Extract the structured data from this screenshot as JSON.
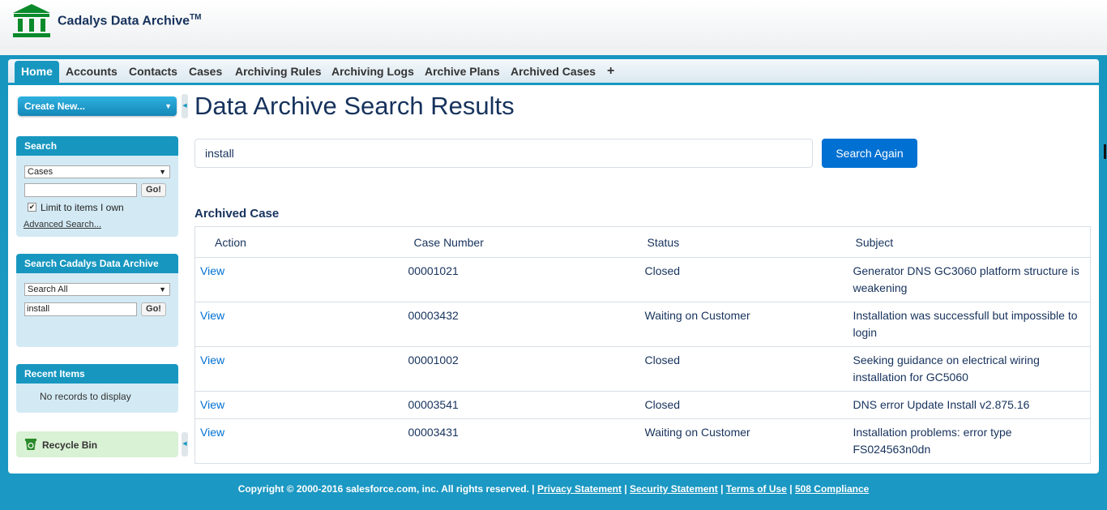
{
  "header": {
    "app_title": "Cadalys Data Archive",
    "trademark": "TM"
  },
  "tabs": [
    {
      "label": "Home",
      "active": true
    },
    {
      "label": "Accounts"
    },
    {
      "label": "Contacts"
    },
    {
      "label": "Cases"
    },
    {
      "label": "Archiving Rules"
    },
    {
      "label": "Archiving Logs"
    },
    {
      "label": "Archive Plans"
    },
    {
      "label": "Archived Cases"
    },
    {
      "label": "+"
    }
  ],
  "sidebar": {
    "create_new": "Create New...",
    "search": {
      "heading": "Search",
      "scope": "Cases",
      "query": "",
      "go": "Go!",
      "limit_label": "Limit to items I own",
      "limit_checked": true,
      "advanced": "Advanced Search..."
    },
    "archive_search": {
      "heading": "Search Cadalys Data Archive",
      "scope": "Search All",
      "query": "install",
      "go": "Go!"
    },
    "recent": {
      "heading": "Recent Items",
      "empty": "No records to display"
    },
    "recycle_bin": "Recycle Bin"
  },
  "main": {
    "title": "Data Archive Search Results",
    "search_value": "install",
    "search_button": "Search Again",
    "section_title": "Archived Case",
    "columns": [
      "Action",
      "Case Number",
      "Status",
      "Subject"
    ],
    "rows": [
      {
        "action": "View",
        "case_number": "00001021",
        "status": "Closed",
        "subject": "Generator DNS GC3060 platform structure is weakening"
      },
      {
        "action": "View",
        "case_number": "00003432",
        "status": "Waiting on Customer",
        "subject": "Installation was successfull but impossible to login"
      },
      {
        "action": "View",
        "case_number": "00001002",
        "status": "Closed",
        "subject": "Seeking guidance on electrical wiring installation for GC5060"
      },
      {
        "action": "View",
        "case_number": "00003541",
        "status": "Closed",
        "subject": "DNS error Update Install v2.875.16"
      },
      {
        "action": "View",
        "case_number": "00003431",
        "status": "Waiting on Customer",
        "subject": "Installation problems: error type FS024563n0dn"
      }
    ]
  },
  "footer": {
    "copyright": "Copyright © 2000-2016 salesforce.com, inc. All rights reserved.",
    "links": [
      "Privacy Statement",
      "Security Statement",
      "Terms of Use",
      "508 Compliance"
    ]
  },
  "colors": {
    "brand": "#1797c0",
    "button": "#0070d2",
    "title": "#16325c",
    "logo": "#0a8a2a"
  }
}
